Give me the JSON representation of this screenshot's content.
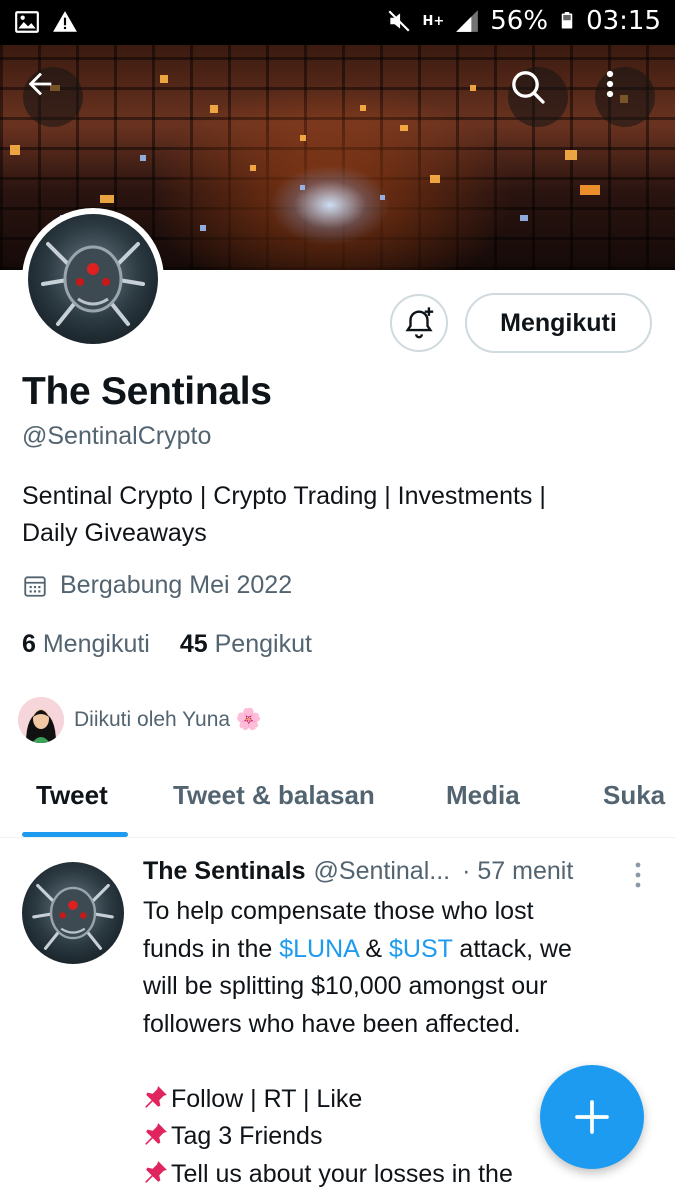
{
  "status_bar": {
    "network": "H+",
    "battery": "56%",
    "time": "03:15"
  },
  "header": {
    "back_icon": "arrow-left-icon",
    "search_icon": "search-icon",
    "more_icon": "more-vertical-icon"
  },
  "profile": {
    "name": "The Sentinals",
    "handle": "@SentinalCrypto",
    "bio_line1": "Sentinal Crypto | Crypto Trading | Investments |",
    "bio_line2": "Daily Giveaways",
    "joined": "Bergabung Mei 2022",
    "following_count": "6",
    "following_label": "Mengikuti",
    "followers_count": "45",
    "followers_label": "Pengikut",
    "followed_by": "Diikuti oleh Yuna 🌸",
    "follow_button": "Mengikuti"
  },
  "tabs": [
    {
      "label": "Tweet",
      "active": true
    },
    {
      "label": "Tweet & balasan",
      "active": false
    },
    {
      "label": "Media",
      "active": false
    },
    {
      "label": "Suka",
      "active": false
    }
  ],
  "tweet": {
    "name": "The Sentinals",
    "handle": "@Sentinal...",
    "time": "· 57 menit",
    "line1": "To help compensate those who lost",
    "line2_pre": "funds in the ",
    "cashtag1": "$LUNA",
    "line2_mid": " & ",
    "cashtag2": "$UST",
    "line2_post": " attack, we",
    "line3": "will be splitting $10,000 amongst our",
    "line4": "followers who have been affected.",
    "line5": "Follow | RT | Like",
    "line6": "Tag 3 Friends",
    "line7": "Tell us about your losses in the"
  },
  "colors": {
    "accent": "#1d9bf0",
    "text": "#0f1419",
    "secondary": "#536471"
  }
}
